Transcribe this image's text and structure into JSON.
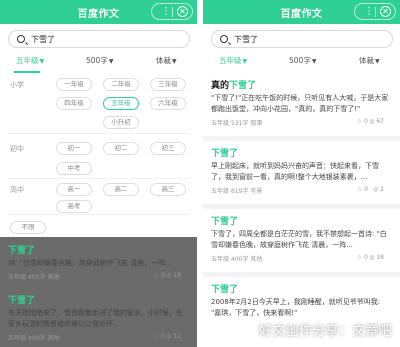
{
  "app": {
    "title": "百度作文",
    "menu_glyph": "⋮",
    "close_glyph": "✕"
  },
  "search": {
    "value": "下雪了"
  },
  "filters": {
    "grade": "五年级",
    "words": "500字",
    "style": "体裁"
  },
  "grade_sheet": {
    "small_label": "小学",
    "small_row1": [
      "一年级",
      "二年级",
      "三年级"
    ],
    "small_row2": [
      "四年级",
      "五年级",
      "六年级"
    ],
    "small_row3": [
      "小升初"
    ],
    "middle_label": "初中",
    "middle_row1": [
      "初一",
      "初二",
      "初三"
    ],
    "middle_row2": [
      "中考"
    ],
    "high_label": "高中",
    "high_row1": [
      "高一",
      "高二",
      "高三"
    ],
    "high_row2": [
      "高考"
    ],
    "other": "不限"
  },
  "left_cards": [
    {
      "title": "下雪了",
      "excerpt": "诗: \"白雪却嫌春色晚，故穿庭树作飞花 清晨，一阵...",
      "grade": "五年级",
      "words": "400字",
      "type": "其他",
      "likes": "0",
      "views": "18"
    },
    {
      "title": "下雪了",
      "excerpt": "冬天悄悄地来了，雪也跟着走进了我的家乡。小时候，在家乡玩雪的情景始终难以让我忘怀...",
      "grade": "五年级",
      "words": "400字",
      "type": "其他",
      "likes": "0",
      "views": "11"
    }
  ],
  "right_cards": [
    {
      "title_prefix": "真的",
      "title": "下雪了",
      "excerpt": "\"下雪了!\"正在吃午饭的时候，只听见有人大喊，于是大家都跑出饭堂，冲向小花园，\"真的，真的下雪了!\"",
      "grade": "五年级",
      "words": "531字",
      "type": "叙事",
      "likes": "0",
      "views": "67"
    },
    {
      "title": "下雪了",
      "excerpt": "早上刚起床，就听到妈妈兴奋的声音：快起来看，下雪了，我到窗前一看，真的啊!整个大地银装素裹，...",
      "grade": "五年级",
      "words": "619字",
      "type": "写景",
      "likes": "0",
      "views": "2"
    },
    {
      "title": "下雪了",
      "excerpt": "下雪了，四周全都是白茫茫的雪，我不禁想起一首诗: \"白雪却嫌春色晚，故穿庭树作飞花 清晨，一阵...",
      "grade": "五年级",
      "words": "400字",
      "type": "其他",
      "likes": "0",
      "views": "18"
    },
    {
      "title": "下雪了",
      "excerpt": "2008年2月2日今天早上，我刚睡醒，就听见爷爷叫我: \"嘉琪，下雪了，快来看啊!\"",
      "grade": "五年级",
      "words": "",
      "type": "",
      "likes": "",
      "views": ""
    }
  ],
  "watermark": "好文创作分享：文章吧",
  "colors": {
    "accent": "#2fcf95"
  }
}
